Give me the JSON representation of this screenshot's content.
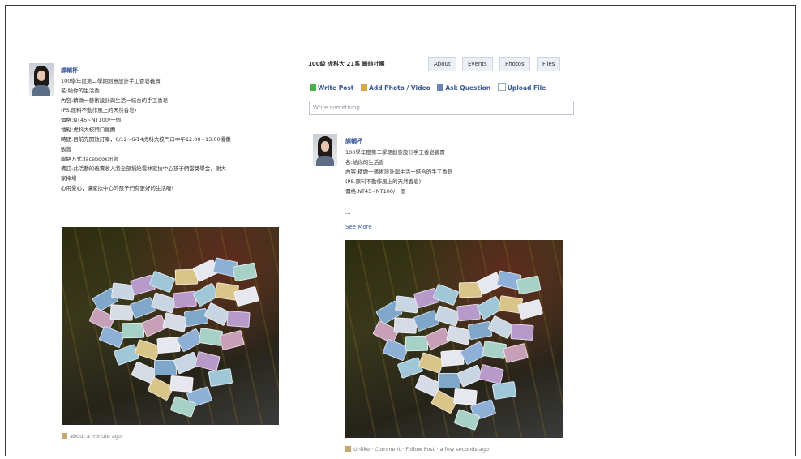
{
  "left_post": {
    "author": "課輔杯",
    "lines": [
      "100學年度第二學期創意設計手工香皂義賣",
      "名:給你的生活香",
      "內容:精緻一藝術設計與生活一結合的手工香皂",
      "(PS.原料不動作風上的天然香皂)",
      "價格:NT45~NT100/一個",
      "地點:虎科大校門口擺攤",
      "時間:目前先開放訂購，6/12~6/14虎科大校門口中午12:00~13:00擺攤",
      "販售",
      "聯絡方式:facebook訊息",
      "備註:此活動的義賣收入將全部捐給雲林家扶中心孩子們當獎學金，謝大",
      "家捧場",
      "心用愛心，讓家扶中心的孩子們有更好的生活喔!"
    ],
    "timestamp": "about a minute ago"
  },
  "group_page": {
    "title": "100級 虎科大 21系 聯誼社團",
    "tabs": [
      "About",
      "Events",
      "Photos",
      "Files"
    ],
    "actions": [
      "Write Post",
      "Add Photo / Video",
      "Ask Question",
      "Upload File"
    ],
    "composer_placeholder": "Write something...",
    "post": {
      "author": "課輔杯",
      "lines": [
        "100學年度第二學期創意設計手工香皂義賣",
        "名:給你的生活香",
        "內容:精緻一藝術設計與生活一結合的手工香皂",
        "(PS.原料不動作風上的天然香皂)",
        "價格:NT45~NT100/一個"
      ],
      "ellipsis": "...",
      "see_more": "See More",
      "footer": "Unlike · Comment · Follow Post · a few seconds ago"
    }
  },
  "colors": {
    "link": "#3b5998",
    "border": "#3a3a3a"
  }
}
